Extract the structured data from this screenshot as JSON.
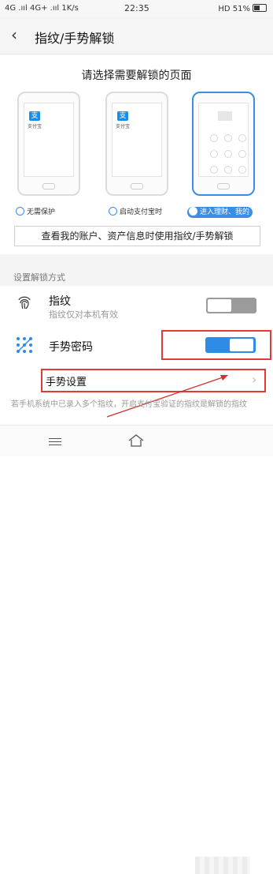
{
  "status_bar": {
    "left": "4G .ııl 4G+ .ııl 1K/s",
    "time": "22:35",
    "right": "HD 51%"
  },
  "header": {
    "title": "指纹/手势解锁"
  },
  "prompt": "请选择需要解锁的页面",
  "phones": {
    "alipay_logo": "支",
    "alipay_label": "支付宝"
  },
  "options": [
    {
      "label": "无需保护"
    },
    {
      "label": "启动支付宝时"
    },
    {
      "label": "进入理财、我的"
    }
  ],
  "info_text": "查看我的账户、资产信息时使用指纹/手势解锁",
  "section_label": "设置解锁方式",
  "fingerprint": {
    "title": "指纹",
    "subtitle": "指纹仅对本机有效",
    "enabled": false
  },
  "gesture_password": {
    "title": "手势密码",
    "enabled": true
  },
  "gesture_settings": {
    "label": "手势设置"
  },
  "note": "若手机系统中已录入多个指纹，开启支付宝验证的指纹是解锁的指纹",
  "colors": {
    "accent": "#2e8be6",
    "highlight": "#e53935"
  }
}
